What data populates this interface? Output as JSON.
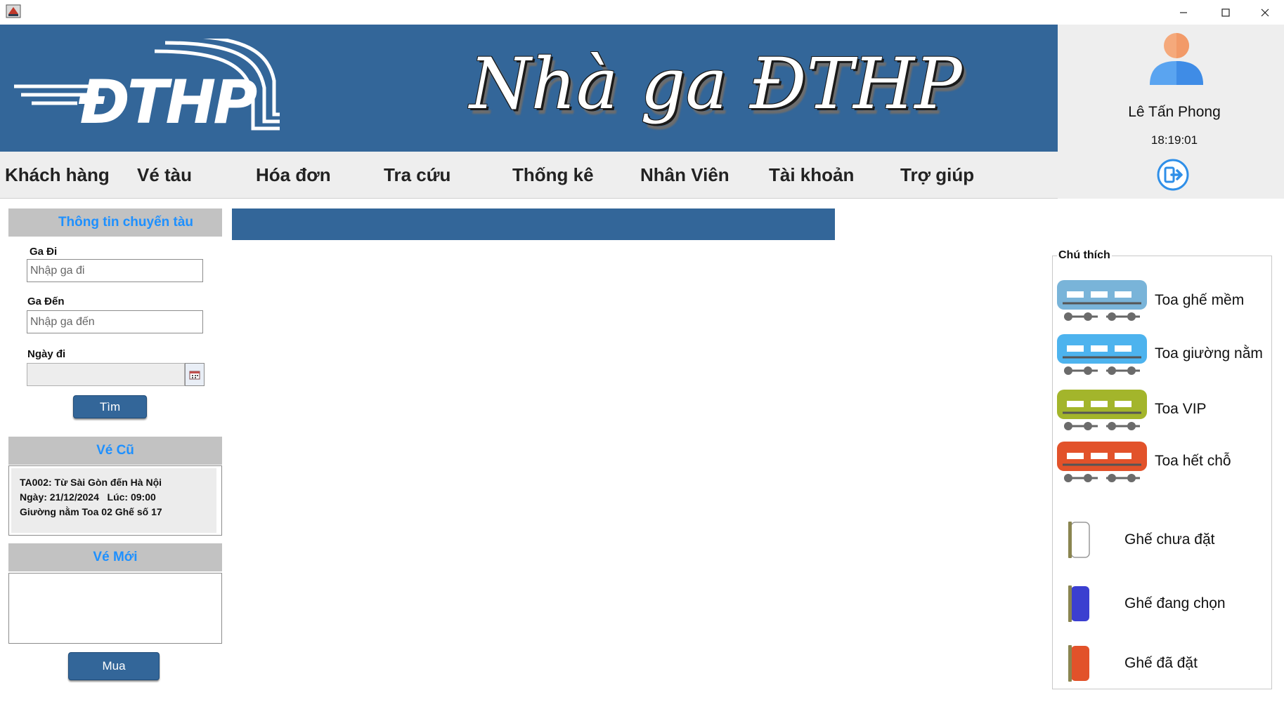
{
  "window": {
    "controls": {
      "minimize": "minimize-icon",
      "maximize": "maximize-icon",
      "close": "close-icon"
    }
  },
  "banner": {
    "logo_text": "ĐTHP",
    "title": "Nhà ga ĐTHP",
    "background": "#336699"
  },
  "user": {
    "name": "Lê Tấn Phong",
    "time": "18:19:01",
    "avatar_icon": "user-avatar-icon",
    "logout_icon": "logout-icon"
  },
  "menu": {
    "items": [
      {
        "label": "Khách hàng"
      },
      {
        "label": "Vé tàu"
      },
      {
        "label": "Hóa đơn"
      },
      {
        "label": "Tra cứu"
      },
      {
        "label": "Thống kê"
      },
      {
        "label": "Nhân Viên"
      },
      {
        "label": "Tài khoản"
      },
      {
        "label": "Trợ giúp"
      }
    ]
  },
  "search": {
    "header": "Thông tin chuyến tàu",
    "from_label": "Ga Đi",
    "from_placeholder": "Nhập ga đi",
    "from_value": "",
    "to_label": "Ga Đến",
    "to_placeholder": "Nhập ga đến",
    "to_value": "",
    "date_label": "Ngày đi",
    "date_value": "",
    "date_icon": "calendar-icon",
    "search_button": "Tìm"
  },
  "old_tickets": {
    "header": "Vé Cũ",
    "items": [
      {
        "line1": "TA002: Từ Sài Gòn đến Hà Nội",
        "line2": "Ngày: 21/12/2024   Lúc: 09:00",
        "line3": "Giường nằm Toa 02 Ghế số 17"
      }
    ]
  },
  "new_tickets": {
    "header": "Vé Mới",
    "items": [],
    "buy_button": "Mua"
  },
  "legend": {
    "title": "Chú thích",
    "coaches": [
      {
        "label": "Toa ghế mềm",
        "color": "#79b4d9"
      },
      {
        "label": "Toa giường nằm",
        "color": "#4db3ee"
      },
      {
        "label": "Toa VIP",
        "color": "#a3b52b"
      },
      {
        "label": "Toa hết chỗ",
        "color": "#e2522a"
      }
    ],
    "seats": [
      {
        "label": "Ghế chưa đặt",
        "color": "#ffffff"
      },
      {
        "label": "Ghế đang chọn",
        "color": "#3b3fd0"
      },
      {
        "label": "Ghế đã đặt",
        "color": "#e2522a"
      }
    ]
  },
  "colors": {
    "brand_blue": "#336699",
    "accent_blue": "#1e90ff",
    "section_gray": "#c2c2c2",
    "panel_gray": "#eeeeee"
  }
}
